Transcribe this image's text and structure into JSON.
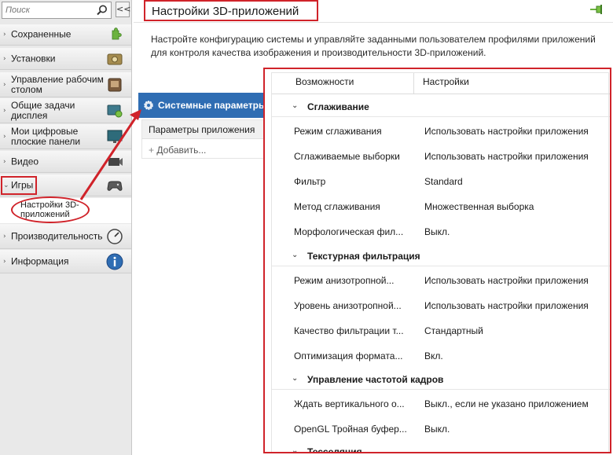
{
  "sidebar": {
    "search_placeholder": "Поиск",
    "collapse_label": "<<",
    "items": [
      {
        "label": "Сохраненные",
        "chevron": "›",
        "icon": "puzzle-icon"
      },
      {
        "label": "Установки",
        "chevron": "›",
        "icon": "settings-panel-icon"
      },
      {
        "label": "Управление рабочим столом",
        "chevron": "›",
        "icon": "desktop-management-icon"
      },
      {
        "label": "Общие задачи дисплея",
        "chevron": "›",
        "icon": "display-tasks-icon"
      },
      {
        "label": "Мои цифровые плоские панели",
        "chevron": "›",
        "icon": "flat-panel-icon"
      },
      {
        "label": "Видео",
        "chevron": "›",
        "icon": "film-icon"
      },
      {
        "label": "Игры",
        "chevron": "⌄",
        "icon": "gamepad-icon"
      },
      {
        "label": "Производительность",
        "chevron": "›",
        "icon": "speedometer-icon"
      },
      {
        "label": "Информация",
        "chevron": "›",
        "icon": "info-icon"
      }
    ],
    "sub_item": {
      "label": "Настройки 3D-приложений"
    }
  },
  "header": {
    "title": "Настройки 3D-приложений",
    "description": "Настройте конфигурацию системы и управляйте заданными пользователем профилями приложений для контроля качества изображения и производительности 3D-приложений."
  },
  "tabs": {
    "system_params": "Системные параметры",
    "app_params": "Параметры приложения",
    "add": "Добавить..."
  },
  "table": {
    "col_features": "Возможности",
    "col_settings": "Настройки",
    "groups": [
      {
        "title": "Сглаживание",
        "rows": [
          {
            "key": "Режим сглаживания",
            "value": "Использовать настройки приложения"
          },
          {
            "key": "Сглаживаемые выборки",
            "value": "Использовать настройки приложения"
          },
          {
            "key": "Фильтр",
            "value": "Standard"
          },
          {
            "key": "Метод сглаживания",
            "value": "Множественная выборка"
          },
          {
            "key": "Морфологическая фил...",
            "value": "Выкл."
          }
        ]
      },
      {
        "title": "Текстурная фильтрация",
        "rows": [
          {
            "key": "Режим анизотропной...",
            "value": "Использовать настройки приложения"
          },
          {
            "key": "Уровень анизотропной...",
            "value": "Использовать настройки приложения"
          },
          {
            "key": "Качество фильтрации т...",
            "value": "Стандартный"
          },
          {
            "key": "Оптимизация формата...",
            "value": "Вкл."
          }
        ]
      },
      {
        "title": "Управление частотой кадров",
        "rows": [
          {
            "key": "Ждать вертикального о...",
            "value": "Выкл., если не указано приложением"
          },
          {
            "key": "OpenGL Тройная буфер...",
            "value": "Выкл."
          }
        ]
      },
      {
        "title": "Тесселяция",
        "rows": []
      }
    ]
  },
  "colors": {
    "highlight": "#d0232a",
    "tab_blue": "#2f6db3",
    "sidebar_bg": "#e9e9e9"
  }
}
